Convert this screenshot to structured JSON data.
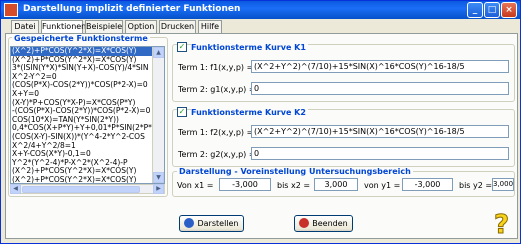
{
  "window": {
    "title": "Darstellung implizit definierter Funktionen",
    "buttons": [
      "_",
      "□",
      "×"
    ]
  },
  "tabs": [
    "Datei",
    "Funktionen",
    "Beispiele",
    "Option",
    "Drucken",
    "Hilfe"
  ],
  "saved": {
    "title": "Gespeicherte Funktionsterme",
    "items": [
      "(X^2)+P*COS(Y^2*X)=X*COS(Y)",
      "(X^2)+P*COS(Y^2*X)=X*COS(Y)",
      "3*(ISIN(Y*X)*SIN(Y+X)-COS(Y)/4*SIN",
      "X^2-Y^2=0",
      "(COS(P*X)-COS(2*Y))*COS(P*2-X)=0",
      "X+Y=0",
      "(X-Y)*P+COS(Y*X-P)=X*COS(P*Y)",
      "-(COS(P*X)-COS(2*Y))*COS(P*2-X)=0",
      "COS(10*X)=TAN(Y*SIN(2*Y))",
      "0,4*COS(X+P*Y)+Y+0,01*P*SIN(2*P*",
      "(COS(X-Y)-SIN(X))*(Y^4-2*Y^2-COS",
      "X^2/4+Y^2/8=1",
      "X+Y-COS(X*Y)-0,1=0",
      "Y^2*(Y^2-4)*P-X^2*(X^2-4)-P",
      "(X^2)+P*COS(Y^2*X)=X*COS(Y)",
      "(X^2)+P*COS(Y^2*X)=X*COS(Y)"
    ]
  },
  "k1": {
    "checkbox": "Funktionsterme Kurve K1",
    "checked": "✓",
    "term1_label": "Term 1: f1(x,y,p) =",
    "term1_value": "(X^2+Y^2)^(7/10)+15*SIN(X)^16*COS(Y)^16-18/5",
    "term2_label": "Term 2: g1(x,y,p) =",
    "term2_value": "0"
  },
  "k2": {
    "checkbox": "Funktionsterme Kurve K2",
    "checked": "✓",
    "term1_label": "Term 1: f2(x,y,p) =",
    "term1_value": "(X^2+Y^2)^(7/10)+15*SIN(X)^16*COS(Y)^16-18/5",
    "term2_label": "Term 2: g2(x,y,p) =",
    "term2_value": "0"
  },
  "range": {
    "title": "Darstellung - Voreinstellung Untersuchungsbereich",
    "x1_label": "Von x1 =",
    "x1": "-3,000",
    "x2_label": "bis x2 =",
    "x2": "3,000",
    "y1_label": "von y1 =",
    "y1": "-3,000",
    "y2_label": "bis y2 =",
    "y2": "3,000"
  },
  "buttons": {
    "darstellen": "Darstellen",
    "beenden": "Beenden"
  },
  "help": {
    "symbol": "?"
  },
  "colors": {
    "accent": "#0046d5",
    "titlebar": "#0a5adf",
    "selection": "#316ac5"
  }
}
